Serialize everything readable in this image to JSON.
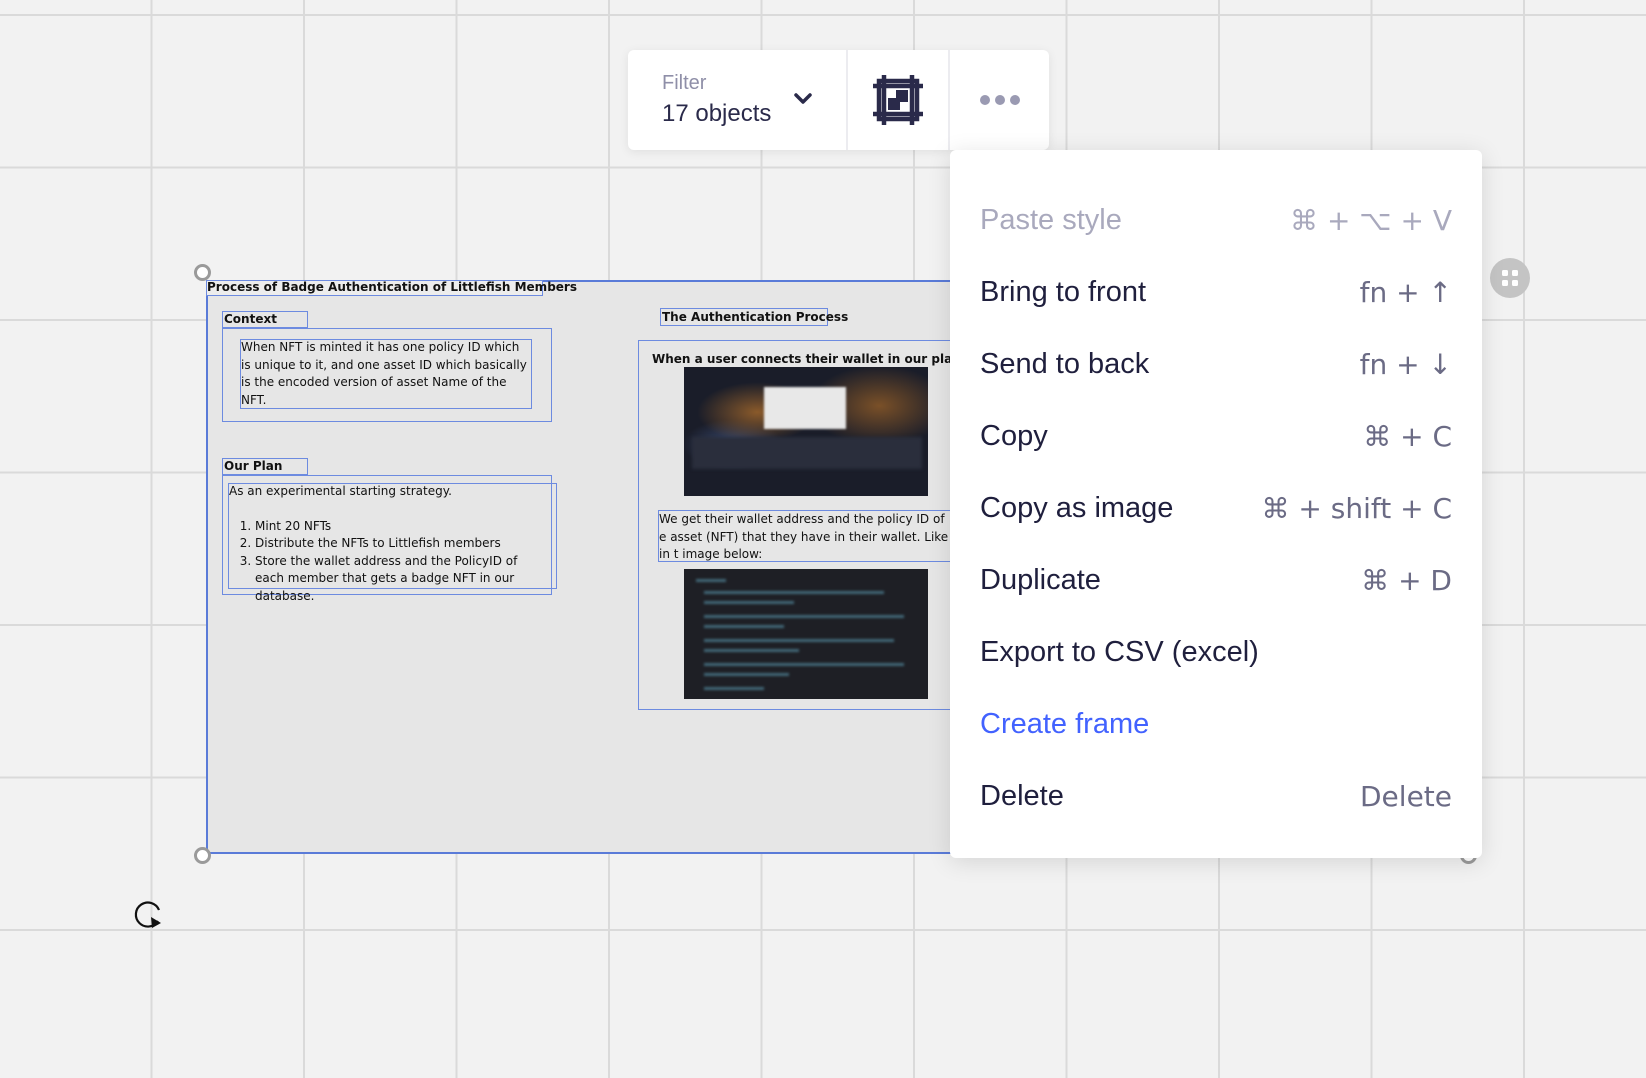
{
  "toolbar": {
    "filter_label": "Filter",
    "filter_value": "17 objects",
    "icons": [
      "chevron-down-icon",
      "frame-icon",
      "more-icon"
    ]
  },
  "menu": {
    "items": [
      {
        "label": "Paste style",
        "shortcut": "⌘ + ⌥ + V",
        "state": "disabled"
      },
      {
        "label": "Bring to front",
        "shortcut": "fn + ↑"
      },
      {
        "label": "Send to back",
        "shortcut": "fn + ↓"
      },
      {
        "label": "Copy",
        "shortcut": "⌘ + C"
      },
      {
        "label": "Copy as image",
        "shortcut": "⌘ + shift + C"
      },
      {
        "label": "Duplicate",
        "shortcut": "⌘ + D"
      },
      {
        "label": "Export to CSV (excel)",
        "shortcut": ""
      },
      {
        "label": "Create frame",
        "shortcut": "",
        "state": "accent"
      },
      {
        "label": "Delete",
        "shortcut": "Delete"
      }
    ]
  },
  "frame": {
    "title": "Process of Badge Authentication of Littlefish Members",
    "context_label": "Context",
    "context_text": "When NFT is minted it has one policy ID which is unique to it, and one asset ID which basically is the encoded version of asset Name of the NFT.",
    "plan_label": "Our Plan",
    "plan_intro": "As an experimental starting strategy.",
    "plan_items": [
      "Mint 20 NFTs",
      "Distribute the NFTs to Littlefish members",
      "Store the wallet address and the PolicyID of each member that gets a badge NFT in our database."
    ],
    "auth_label": "The Authentication Process",
    "auth_sub": "When a user connects their wallet in our platf",
    "auth_text": "We get their wallet address and the policy ID of e asset (NFT) that they have in their wallet. Like in t image below:"
  },
  "colors": {
    "accent": "#4262ff",
    "selection": "#5a7bd8",
    "menu_text": "#1f1f3d",
    "shortcut_text": "#6b6b85",
    "disabled_text": "#a9a9bd",
    "canvas": "#f2f2f2"
  }
}
